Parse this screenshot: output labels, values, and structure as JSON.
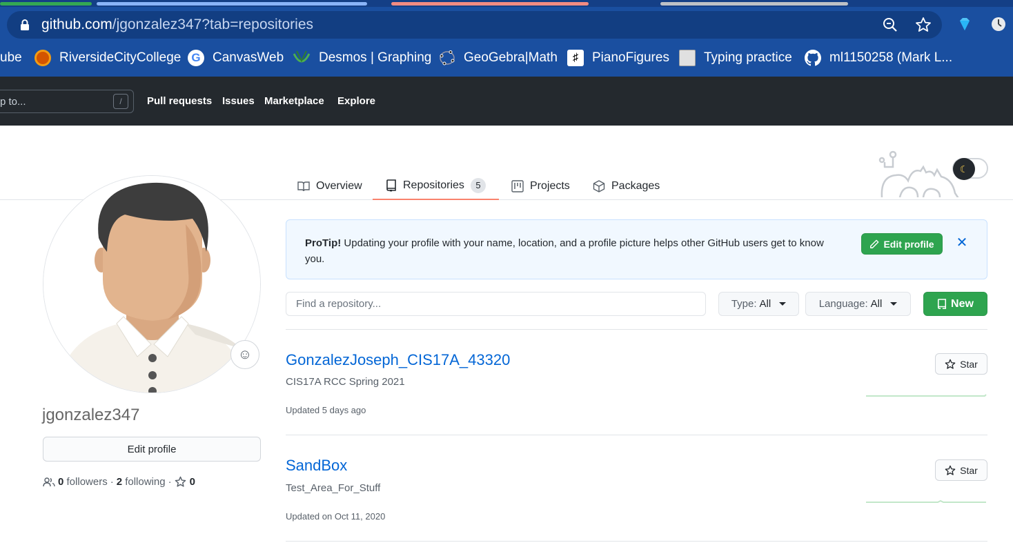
{
  "browser": {
    "url_host": "github.com",
    "url_path": "/jgonzalez347?tab=repositories",
    "bookmarks": [
      {
        "label": "ube"
      },
      {
        "label": "RiversideCityCollege"
      },
      {
        "label": "CanvasWeb"
      },
      {
        "label": "Desmos | Graphing"
      },
      {
        "label": "GeoGebra|Math"
      },
      {
        "label": "PianoFigures"
      },
      {
        "label": "Typing practice"
      },
      {
        "label": "ml1150258 (Mark L..."
      }
    ]
  },
  "header": {
    "search_placeholder": "p to...",
    "search_key": "/",
    "nav": [
      "Pull requests",
      "Issues",
      "Marketplace",
      "Explore"
    ]
  },
  "tabs": [
    {
      "label": "Overview",
      "icon": "book-icon"
    },
    {
      "label": "Repositories",
      "icon": "repo-icon",
      "count": "5"
    },
    {
      "label": "Projects",
      "icon": "project-icon"
    },
    {
      "label": "Packages",
      "icon": "package-icon"
    }
  ],
  "profile": {
    "username": "jgonzalez347",
    "edit_label": "Edit profile",
    "followers_count": "0",
    "followers_label": "followers",
    "following_count": "2",
    "following_label": "following",
    "stars_count": "0"
  },
  "protip": {
    "lead": "ProTip!",
    "text": " Updating your profile with your name, location, and a profile picture helps other GitHub users get to know you.",
    "button": "Edit profile"
  },
  "filters": {
    "search_placeholder": "Find a repository...",
    "type_label": "Type:",
    "type_value": "All",
    "language_label": "Language:",
    "language_value": "All",
    "new_label": "New"
  },
  "repos": [
    {
      "name": "GonzalezJoseph_CIS17A_43320",
      "description": "CIS17A RCC Spring 2021",
      "updated": "Updated 5 days ago",
      "star_label": "Star"
    },
    {
      "name": "SandBox",
      "description": "Test_Area_For_Stuff",
      "updated": "Updated on Oct 11, 2020",
      "star_label": "Star"
    }
  ],
  "colors": {
    "accent_green": "#2ea44f",
    "link_blue": "#0366d6",
    "tab_underline": "#f9826c",
    "header_dark": "#24292e"
  }
}
